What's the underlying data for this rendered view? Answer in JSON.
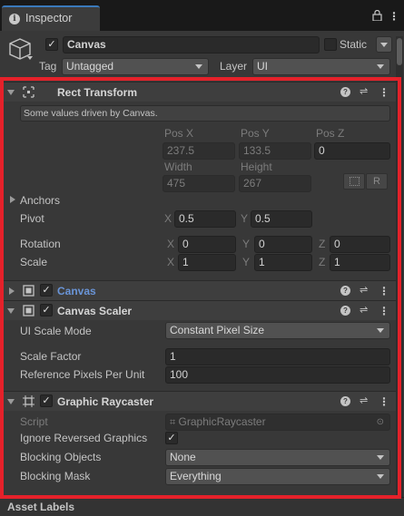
{
  "tab": {
    "title": "Inspector",
    "info_icon": "info-icon",
    "lock_icon": "lock-icon",
    "menu_icon": "kebab-icon"
  },
  "gameobject": {
    "name": "Canvas",
    "active": true,
    "static_label": "Static",
    "static_checked": false,
    "tag_label": "Tag",
    "tag_value": "Untagged",
    "layer_label": "Layer",
    "layer_value": "UI",
    "icon": "cube-icon"
  },
  "rect_transform": {
    "title": "Rect Transform",
    "info_message": "Some values driven by Canvas.",
    "pos_x_label": "Pos X",
    "pos_y_label": "Pos Y",
    "pos_z_label": "Pos Z",
    "pos_x": "237.5",
    "pos_y": "133.5",
    "pos_z": "0",
    "width_label": "Width",
    "height_label": "Height",
    "width": "475",
    "height": "267",
    "r_button": "R",
    "anchors_label": "Anchors",
    "pivot_label": "Pivot",
    "pivot_x_label": "X",
    "pivot_x": "0.5",
    "pivot_y_label": "Y",
    "pivot_y": "0.5",
    "rotation_label": "Rotation",
    "rot_x": "0",
    "rot_y": "0",
    "rot_z": "0",
    "scale_label": "Scale",
    "scale_x": "1",
    "scale_y": "1",
    "scale_z": "1",
    "x_label": "X",
    "y_label": "Y",
    "z_label": "Z"
  },
  "canvas": {
    "title": "Canvas",
    "enabled": true,
    "title_color": "#6a95d8"
  },
  "canvas_scaler": {
    "title": "Canvas Scaler",
    "enabled": true,
    "ui_scale_mode_label": "UI Scale Mode",
    "ui_scale_mode_value": "Constant Pixel Size",
    "scale_factor_label": "Scale Factor",
    "scale_factor": "1",
    "ref_ppu_label": "Reference Pixels Per Unit",
    "ref_ppu": "100"
  },
  "graphic_raycaster": {
    "title": "Graphic Raycaster",
    "enabled": true,
    "script_label": "Script",
    "script_value": "GraphicRaycaster",
    "ignore_reversed_label": "Ignore Reversed Graphics",
    "ignore_reversed_checked": true,
    "blocking_objects_label": "Blocking Objects",
    "blocking_objects_value": "None",
    "blocking_mask_label": "Blocking Mask",
    "blocking_mask_value": "Everything"
  },
  "footer": {
    "asset_labels": "Asset Labels"
  },
  "colors": {
    "highlight": "#e5212a",
    "tab_accent": "#3a79bb",
    "panel_bg": "#383838"
  }
}
